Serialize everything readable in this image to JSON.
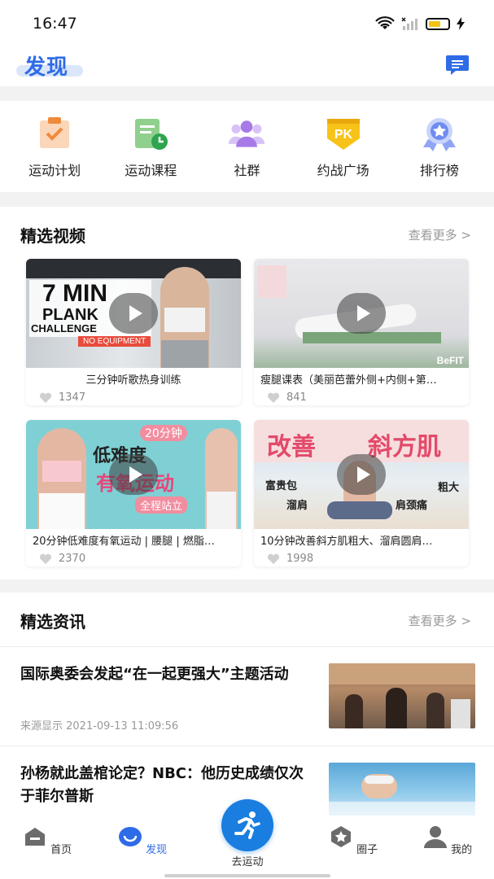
{
  "status_bar": {
    "time": "16:47"
  },
  "header": {
    "title": "发现"
  },
  "quick_nav": [
    {
      "label": "运动计划",
      "icon": "clipboard-check-icon"
    },
    {
      "label": "运动课程",
      "icon": "course-clock-icon"
    },
    {
      "label": "社群",
      "icon": "community-icon"
    },
    {
      "label": "约战广场",
      "icon": "pk-badge-icon"
    },
    {
      "label": "排行榜",
      "icon": "ranking-medal-icon"
    }
  ],
  "videos_section": {
    "title": "精选视频",
    "more": "查看更多 >",
    "items": [
      {
        "title": "三分钟听歌热身训练",
        "likes": "1347",
        "thumb_text": [
          "7 MIN",
          "PLANK",
          "CHALLENGE",
          "NO EQUIPMENT"
        ]
      },
      {
        "title": "瘦腿课表（美丽芭蕾外侧+内侧+第…",
        "likes": "841",
        "thumb_text": [
          "BeFIT"
        ]
      },
      {
        "title": "20分钟低难度有氧运动 | 腰腿 | 燃脂…",
        "likes": "2370",
        "thumb_text": [
          "20分钟",
          "低难度",
          "有氧运动",
          "全程站立"
        ]
      },
      {
        "title": "10分钟改善斜方肌粗大、溜肩圆肩…",
        "likes": "1998",
        "thumb_text": [
          "改善",
          "斜方肌",
          "富贵包",
          "粗大",
          "溜肩",
          "肩颈痛"
        ]
      }
    ]
  },
  "news_section": {
    "title": "精选资讯",
    "more": "查看更多 >",
    "items": [
      {
        "title": "国际奥委会发起“在一起更强大”主题活动",
        "meta": "来源显示 2021-09-13 11:09:56"
      },
      {
        "title": "孙杨就此盖棺论定？NBC：他历史成绩仅次于菲尔普斯",
        "meta": ""
      }
    ]
  },
  "tab_bar": {
    "home": "首页",
    "discover": "发现",
    "workout": "去运动",
    "circle": "圈子",
    "mine": "我的"
  },
  "colors": {
    "accent": "#2e6be6",
    "fab": "#1a7de0"
  }
}
